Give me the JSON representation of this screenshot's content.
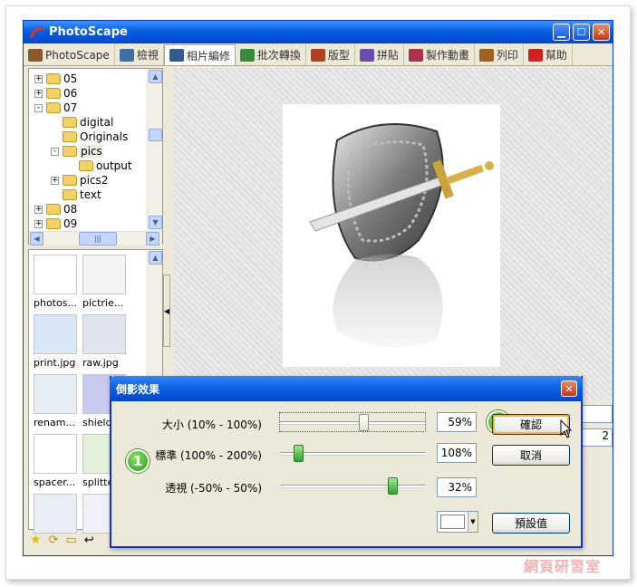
{
  "window": {
    "title": "PhotoScape"
  },
  "tabs": [
    {
      "label": "PhotoScape",
      "color": "#8a5a2b"
    },
    {
      "label": "檢視",
      "color": "#3f6ea5"
    },
    {
      "label": "相片編修",
      "color": "#345b8f"
    },
    {
      "label": "批次轉換",
      "color": "#3a8a3a"
    },
    {
      "label": "版型",
      "color": "#b04020"
    },
    {
      "label": "拼貼",
      "color": "#6a4bb0"
    },
    {
      "label": "製作動畫",
      "color": "#b03050"
    },
    {
      "label": "列印",
      "color": "#a06020"
    },
    {
      "label": "幫助",
      "color": "#d02020"
    }
  ],
  "tree": [
    {
      "label": "05",
      "expander": "+",
      "level": 0
    },
    {
      "label": "06",
      "expander": "+",
      "level": 0
    },
    {
      "label": "07",
      "expander": "-",
      "level": 0
    },
    {
      "label": "digital",
      "expander": "",
      "level": 1
    },
    {
      "label": "Originals",
      "expander": "",
      "level": 1
    },
    {
      "label": "pics",
      "expander": "-",
      "level": 1,
      "selected": true
    },
    {
      "label": "output",
      "expander": "",
      "level": 2
    },
    {
      "label": "pics2",
      "expander": "+",
      "level": 1
    },
    {
      "label": "text",
      "expander": "",
      "level": 1
    },
    {
      "label": "08",
      "expander": "+",
      "level": 0
    },
    {
      "label": "09",
      "expander": "+",
      "level": 0
    }
  ],
  "thumbnails": [
    {
      "caption": "photos..."
    },
    {
      "caption": "pictrie..."
    },
    {
      "caption": "print.jpg"
    },
    {
      "caption": "raw.jpg"
    },
    {
      "caption": "renam..."
    },
    {
      "caption": "shield"
    },
    {
      "caption": "spacer..."
    },
    {
      "caption": "splitte..."
    },
    {
      "caption": ""
    },
    {
      "caption": ""
    }
  ],
  "side_fields": [
    "",
    "2"
  ],
  "dialog": {
    "title": "倒影效果",
    "rows": [
      {
        "label": "大小 (10% - 100%)",
        "value": "59%",
        "position": 0.59
      },
      {
        "label": "標準 (100% - 200%)",
        "value": "108%",
        "position": 0.08
      },
      {
        "label": "透視 (-50% - 50%)",
        "value": "32%",
        "position": 0.82
      }
    ],
    "ok_label": "確認",
    "cancel_label": "取消",
    "default_label": "預設值",
    "badge1": "1",
    "badge2": "2",
    "reflection_color": "#ffffff"
  },
  "watermark": "網頁研習室"
}
